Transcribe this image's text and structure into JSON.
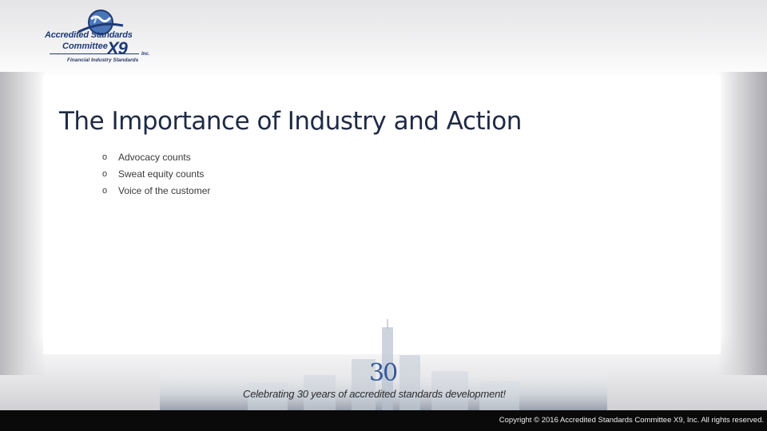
{
  "logo": {
    "line1": "Accredited Standards",
    "line2": "Committee",
    "mark": "X9",
    "inc": "Inc.",
    "tagline": "Financial Industry Standards",
    "icon": "globe-swoosh-icon"
  },
  "slide": {
    "title": "The Importance of Industry and Action",
    "bullet_marker": "o",
    "bullets": [
      "Advocacy counts",
      "Sweat equity counts",
      "Voice of the customer"
    ]
  },
  "footer": {
    "anniversary_number": "30",
    "tagline": "Celebrating 30 years of accredited standards development!",
    "copyright": "Copyright © 2016 Accredited Standards Committee X9, Inc. All rights reserved."
  },
  "colors": {
    "brand_blue": "#1f3a77",
    "title": "#1f2a44",
    "footer_bar": "#0a0a0a",
    "anniversary": "#33599a"
  }
}
